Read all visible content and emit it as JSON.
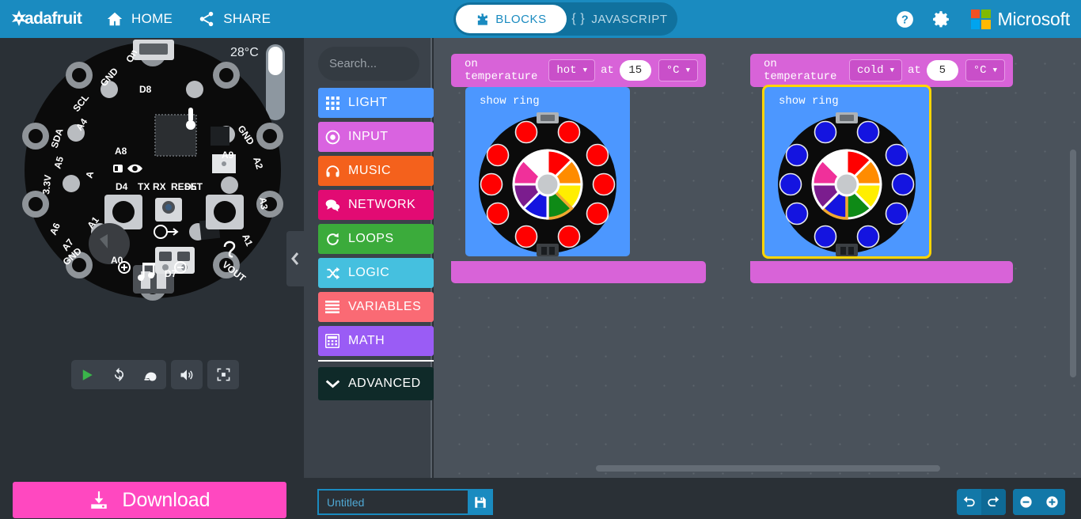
{
  "header": {
    "brand": "adafruit",
    "nav": [
      {
        "id": "home",
        "label": "HOME",
        "icon": "home-icon"
      },
      {
        "id": "share",
        "label": "SHARE",
        "icon": "share-icon"
      }
    ],
    "toggle": {
      "blocks_label": "BLOCKS",
      "blocks_icon": "puzzle-icon",
      "javascript_label": "JAVASCRIPT",
      "javascript_icon": "braces-icon",
      "active": "BLOCKS"
    },
    "help_icon": "help-icon",
    "settings_icon": "gear-icon",
    "microsoft_label": "Microsoft",
    "colors": {
      "bar": "#1a8bc0",
      "toggle_track": "#10719e",
      "ms_red": "#f25022",
      "ms_green": "#7fba00",
      "ms_blue": "#00a4ef",
      "ms_yellow": "#ffb900"
    }
  },
  "simulator": {
    "board_name": "Circuit Playground Express",
    "temperature_readout": "28°C",
    "temperature_slider_value": 28,
    "pin_labels": [
      "On",
      "GND",
      "D8",
      "SCL",
      "A4",
      "SDA",
      "A5",
      "3.3V",
      "A1",
      "A8",
      "D4",
      "TX",
      "RESET",
      "RX",
      "D5",
      "A2",
      "GND",
      "A7",
      "A0",
      "D7",
      "GND",
      "VOUT",
      "A6",
      "A3"
    ],
    "controls": [
      {
        "id": "run",
        "label": "Run",
        "icon": "play-icon"
      },
      {
        "id": "restart",
        "label": "Restart",
        "icon": "refresh-icon"
      },
      {
        "id": "slow-motion",
        "label": "Slow-Mo",
        "icon": "snail-icon"
      },
      {
        "id": "mute",
        "label": "Mute",
        "icon": "speaker-icon"
      },
      {
        "id": "fullscreen",
        "label": "Fullscreen",
        "icon": "fullscreen-icon"
      }
    ]
  },
  "toolbox": {
    "collapse_icon": "chevron-left-icon",
    "search": {
      "placeholder": "Search...",
      "value": "",
      "icon": "search-icon"
    },
    "categories": [
      {
        "id": "light",
        "label": "LIGHT",
        "color": "#4c97ff",
        "icon": "grid-icon"
      },
      {
        "id": "input",
        "label": "INPUT",
        "color": "#d963e0",
        "icon": "target-icon"
      },
      {
        "id": "music",
        "label": "MUSIC",
        "color": "#f4611c",
        "icon": "headphones-icon"
      },
      {
        "id": "network",
        "label": "NETWORK",
        "color": "#e20b73",
        "icon": "chat-icon"
      },
      {
        "id": "loops",
        "label": "LOOPS",
        "color": "#3bab3b",
        "icon": "loop-icon"
      },
      {
        "id": "logic",
        "label": "LOGIC",
        "color": "#45c0df",
        "icon": "shuffle-icon"
      },
      {
        "id": "variables",
        "label": "VARIABLES",
        "color": "#fa6a74",
        "icon": "lines-icon"
      },
      {
        "id": "math",
        "label": "MATH",
        "color": "#9a5cf5",
        "icon": "calculator-icon"
      }
    ],
    "advanced": {
      "id": "advanced",
      "label": "ADVANCED",
      "color": "#0f2a29",
      "icon": "chevron-down-icon"
    }
  },
  "workspace": {
    "blocks": [
      {
        "id": "event-hot",
        "prefix": "on temperature",
        "condition": "hot",
        "at_label": "at",
        "threshold": "15",
        "unit": "°C",
        "child_label": "show ring",
        "selected": false,
        "ring": {
          "led_color": "#ff0000",
          "led_count": 10,
          "wheel_selected_index": 5,
          "wheel_colors": [
            "#ff0000",
            "#ff8c00",
            "#ffee00",
            "#0e8a16",
            "#1414e0",
            "#7b1d8e",
            "#f0309a",
            "#ffffff"
          ]
        }
      },
      {
        "id": "event-cold",
        "prefix": "on temperature",
        "condition": "cold",
        "at_label": "at",
        "threshold": "5",
        "unit": "°C",
        "child_label": "show ring",
        "selected": true,
        "ring": {
          "led_color": "#1414e0",
          "led_count": 10,
          "wheel_selected_index": 4,
          "wheel_colors": [
            "#ff0000",
            "#ff8c00",
            "#ffee00",
            "#0e8a16",
            "#1414e0",
            "#7b1d8e",
            "#f0309a",
            "#ffffff"
          ]
        }
      }
    ],
    "scrollbar_horizontal": true,
    "scrollbar_vertical": true,
    "colors": {
      "event_block": "#d863d8",
      "inner_block": "#4c97ff",
      "selection_outline": "#ffd500",
      "canvas": "#4a525b"
    }
  },
  "bottombar": {
    "download_label": "Download",
    "download_icon": "download-icon",
    "project_name": {
      "value": "",
      "placeholder": "Untitled"
    },
    "save_icon": "floppy-icon",
    "controls": [
      {
        "id": "undo",
        "label": "Undo",
        "icon": "undo-icon"
      },
      {
        "id": "redo",
        "label": "Redo",
        "icon": "redo-icon"
      },
      {
        "id": "zoom-out",
        "label": "Zoom out",
        "icon": "minus-circle-icon"
      },
      {
        "id": "zoom-in",
        "label": "Zoom in",
        "icon": "plus-circle-icon"
      }
    ]
  }
}
